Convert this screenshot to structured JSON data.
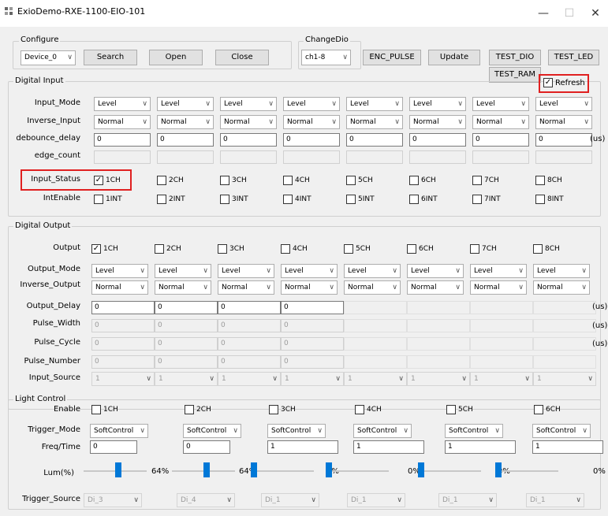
{
  "window": {
    "title": "ExioDemo-RXE-1100-EIO-101",
    "minimize": "—",
    "maximize": "☐",
    "close": "✕"
  },
  "configure": {
    "group_label": "Configure",
    "device": "Device_0",
    "search": "Search",
    "open": "Open",
    "close": "Close"
  },
  "changedio": {
    "group_label": "ChangeDio",
    "value": "ch1-8"
  },
  "toolbar": {
    "enc_pulse": "ENC_PULSE",
    "update": "Update",
    "test_dio": "TEST_DIO",
    "test_led": "TEST_LED",
    "test_ram": "TEST_RAM",
    "refresh": "Refresh",
    "refresh_checked": true
  },
  "digital_input": {
    "group_label": "Digital Input",
    "labels": {
      "input_mode": "Input_Mode",
      "inverse_input": "Inverse_Input",
      "debounce_delay": "debounce_delay",
      "edge_count": "edge_count",
      "input_status": "Input_Status",
      "intenable": "IntEnable"
    },
    "input_mode": [
      "Level",
      "Level",
      "Level",
      "Level",
      "Level",
      "Level",
      "Level",
      "Level"
    ],
    "inverse_input": [
      "Normal",
      "Normal",
      "Normal",
      "Normal",
      "Normal",
      "Normal",
      "Normal",
      "Normal"
    ],
    "debounce_delay": [
      "0",
      "0",
      "0",
      "0",
      "0",
      "0",
      "0",
      "0"
    ],
    "debounce_unit": "(us)",
    "input_status": [
      {
        "label": "1CH",
        "checked": true
      },
      {
        "label": "2CH",
        "checked": false
      },
      {
        "label": "3CH",
        "checked": false
      },
      {
        "label": "4CH",
        "checked": false
      },
      {
        "label": "5CH",
        "checked": false
      },
      {
        "label": "6CH",
        "checked": false
      },
      {
        "label": "7CH",
        "checked": false
      },
      {
        "label": "8CH",
        "checked": false
      }
    ],
    "intenable": [
      {
        "label": "1INT"
      },
      {
        "label": "2INT"
      },
      {
        "label": "3INT"
      },
      {
        "label": "4INT"
      },
      {
        "label": "5INT"
      },
      {
        "label": "6INT"
      },
      {
        "label": "7INT"
      },
      {
        "label": "8INT"
      }
    ]
  },
  "digital_output": {
    "group_label": "Digital Output",
    "labels": {
      "output": "Output",
      "output_mode": "Output_Mode",
      "inverse_output": "Inverse_Output",
      "output_delay": "Output_Delay",
      "pulse_width": "Pulse_Width",
      "pulse_cycle": "Pulse_Cycle",
      "pulse_number": "Pulse_Number",
      "input_source": "Input_Source"
    },
    "output": [
      {
        "label": "1CH",
        "checked": true
      },
      {
        "label": "2CH",
        "checked": false
      },
      {
        "label": "3CH",
        "checked": false
      },
      {
        "label": "4CH",
        "checked": false
      },
      {
        "label": "5CH",
        "checked": false
      },
      {
        "label": "6CH",
        "checked": false
      },
      {
        "label": "7CH",
        "checked": false
      },
      {
        "label": "8CH",
        "checked": false
      }
    ],
    "output_mode": [
      "Level",
      "Level",
      "Level",
      "Level",
      "Level",
      "Level",
      "Level",
      "Level"
    ],
    "inverse_output": [
      "Normal",
      "Normal",
      "Normal",
      "Normal",
      "Normal",
      "Normal",
      "Normal",
      "Normal"
    ],
    "output_delay": [
      "0",
      "0",
      "0",
      "0",
      "",
      "",
      "",
      ""
    ],
    "pulse_width": [
      "0",
      "0",
      "0",
      "0",
      "",
      "",
      "",
      ""
    ],
    "pulse_cycle": [
      "0",
      "0",
      "0",
      "0",
      "",
      "",
      "",
      ""
    ],
    "pulse_number": [
      "0",
      "0",
      "0",
      "0",
      "",
      "",
      "",
      ""
    ],
    "input_source": [
      "1",
      "1",
      "1",
      "1",
      "1",
      "1",
      "1",
      "1"
    ],
    "unit": "(us)"
  },
  "light_control": {
    "group_label": "Light Control",
    "labels": {
      "enable": "Enable",
      "trigger_mode": "Trigger_Mode",
      "freq_time": "Freq/Time",
      "lum": "Lum(%)",
      "trigger_source": "Trigger_Source"
    },
    "enable": [
      {
        "label": "1CH"
      },
      {
        "label": "2CH"
      },
      {
        "label": "3CH"
      },
      {
        "label": "4CH"
      },
      {
        "label": "5CH"
      },
      {
        "label": "6CH"
      }
    ],
    "trigger_mode": [
      "SoftControl",
      "SoftControl",
      "SoftControl",
      "SoftControl",
      "SoftControl",
      "SoftControl"
    ],
    "freq_time": [
      "0",
      "0",
      "1",
      "1",
      "1",
      "1"
    ],
    "lum": [
      {
        "value": 64,
        "text": "64%"
      },
      {
        "value": 64,
        "text": "64%"
      },
      {
        "value": 0,
        "text": "0%"
      },
      {
        "value": 0,
        "text": "0%"
      },
      {
        "value": 0,
        "text": "0%"
      },
      {
        "value": 0,
        "text": "0%"
      }
    ],
    "trigger_source": [
      "Di_3",
      "Di_4",
      "Di_1",
      "Di_1",
      "Di_1",
      "Di_1"
    ]
  }
}
